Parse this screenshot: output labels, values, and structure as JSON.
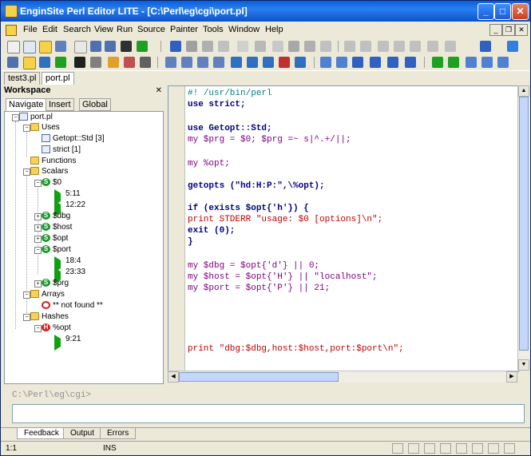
{
  "window": {
    "title": "EnginSite Perl Editor LITE - [C:\\Perl\\eg\\cgi\\port.pl]"
  },
  "menu": [
    "File",
    "Edit",
    "Search",
    "View",
    "Run",
    "Source",
    "Painter",
    "Tools",
    "Window",
    "Help"
  ],
  "doc_tabs": [
    "test3.pl",
    "port.pl"
  ],
  "workspace": {
    "title": "Workspace",
    "tabs": [
      "Navigate",
      "Insert",
      "Global"
    ],
    "tree": [
      {
        "label": "port.pl",
        "kind": "doc"
      },
      {
        "label": "Uses",
        "kind": "folder"
      },
      {
        "label": "Getopt::Std [3]",
        "kind": "doc"
      },
      {
        "label": "strict [1]",
        "kind": "doc"
      },
      {
        "label": "Functions",
        "kind": "folder"
      },
      {
        "label": "Scalars",
        "kind": "folder"
      },
      {
        "label": "$0",
        "kind": "scalar"
      },
      {
        "label": "5:11",
        "kind": "ref"
      },
      {
        "label": "12:22",
        "kind": "ref"
      },
      {
        "label": "$dbg",
        "kind": "scalar"
      },
      {
        "label": "$host",
        "kind": "scalar"
      },
      {
        "label": "$opt",
        "kind": "scalar"
      },
      {
        "label": "$port",
        "kind": "scalar"
      },
      {
        "label": "18:4",
        "kind": "ref"
      },
      {
        "label": "23:33",
        "kind": "ref"
      },
      {
        "label": "$prg",
        "kind": "scalar"
      },
      {
        "label": "Arrays",
        "kind": "folder"
      },
      {
        "label": "** not found **",
        "kind": "error"
      },
      {
        "label": "Hashes",
        "kind": "folder"
      },
      {
        "label": "%opt",
        "kind": "hash"
      },
      {
        "label": "9:21",
        "kind": "ref"
      }
    ]
  },
  "code": [
    "#! /usr/bin/perl",
    "use strict;",
    "",
    "use Getopt::Std;",
    "my $prg = $0; $prg =~ s|^.+/||;",
    "",
    "my %opt;",
    "",
    "getopts (\"hd:H:P:\",\\%opt);",
    "",
    "if (exists $opt{'h'}) {",
    "print STDERR \"usage: $0 [options]\\n\";",
    "exit (0);",
    "}",
    "",
    "my $dbg = $opt{'d'} || 0;",
    "my $host = $opt{'H'} || \"localhost\";",
    "my $port = $opt{'P'} || 21;",
    "",
    "",
    "",
    "",
    "",
    "print \"dbg:$dbg,host:$host,port:$port\\n\";"
  ],
  "console": {
    "prompt": "C:\\Perl\\eg\\cgi>"
  },
  "bottom_tabs": [
    "Feedback",
    "Output",
    "Errors"
  ],
  "status": {
    "position": "1:1",
    "mode": "INS"
  }
}
